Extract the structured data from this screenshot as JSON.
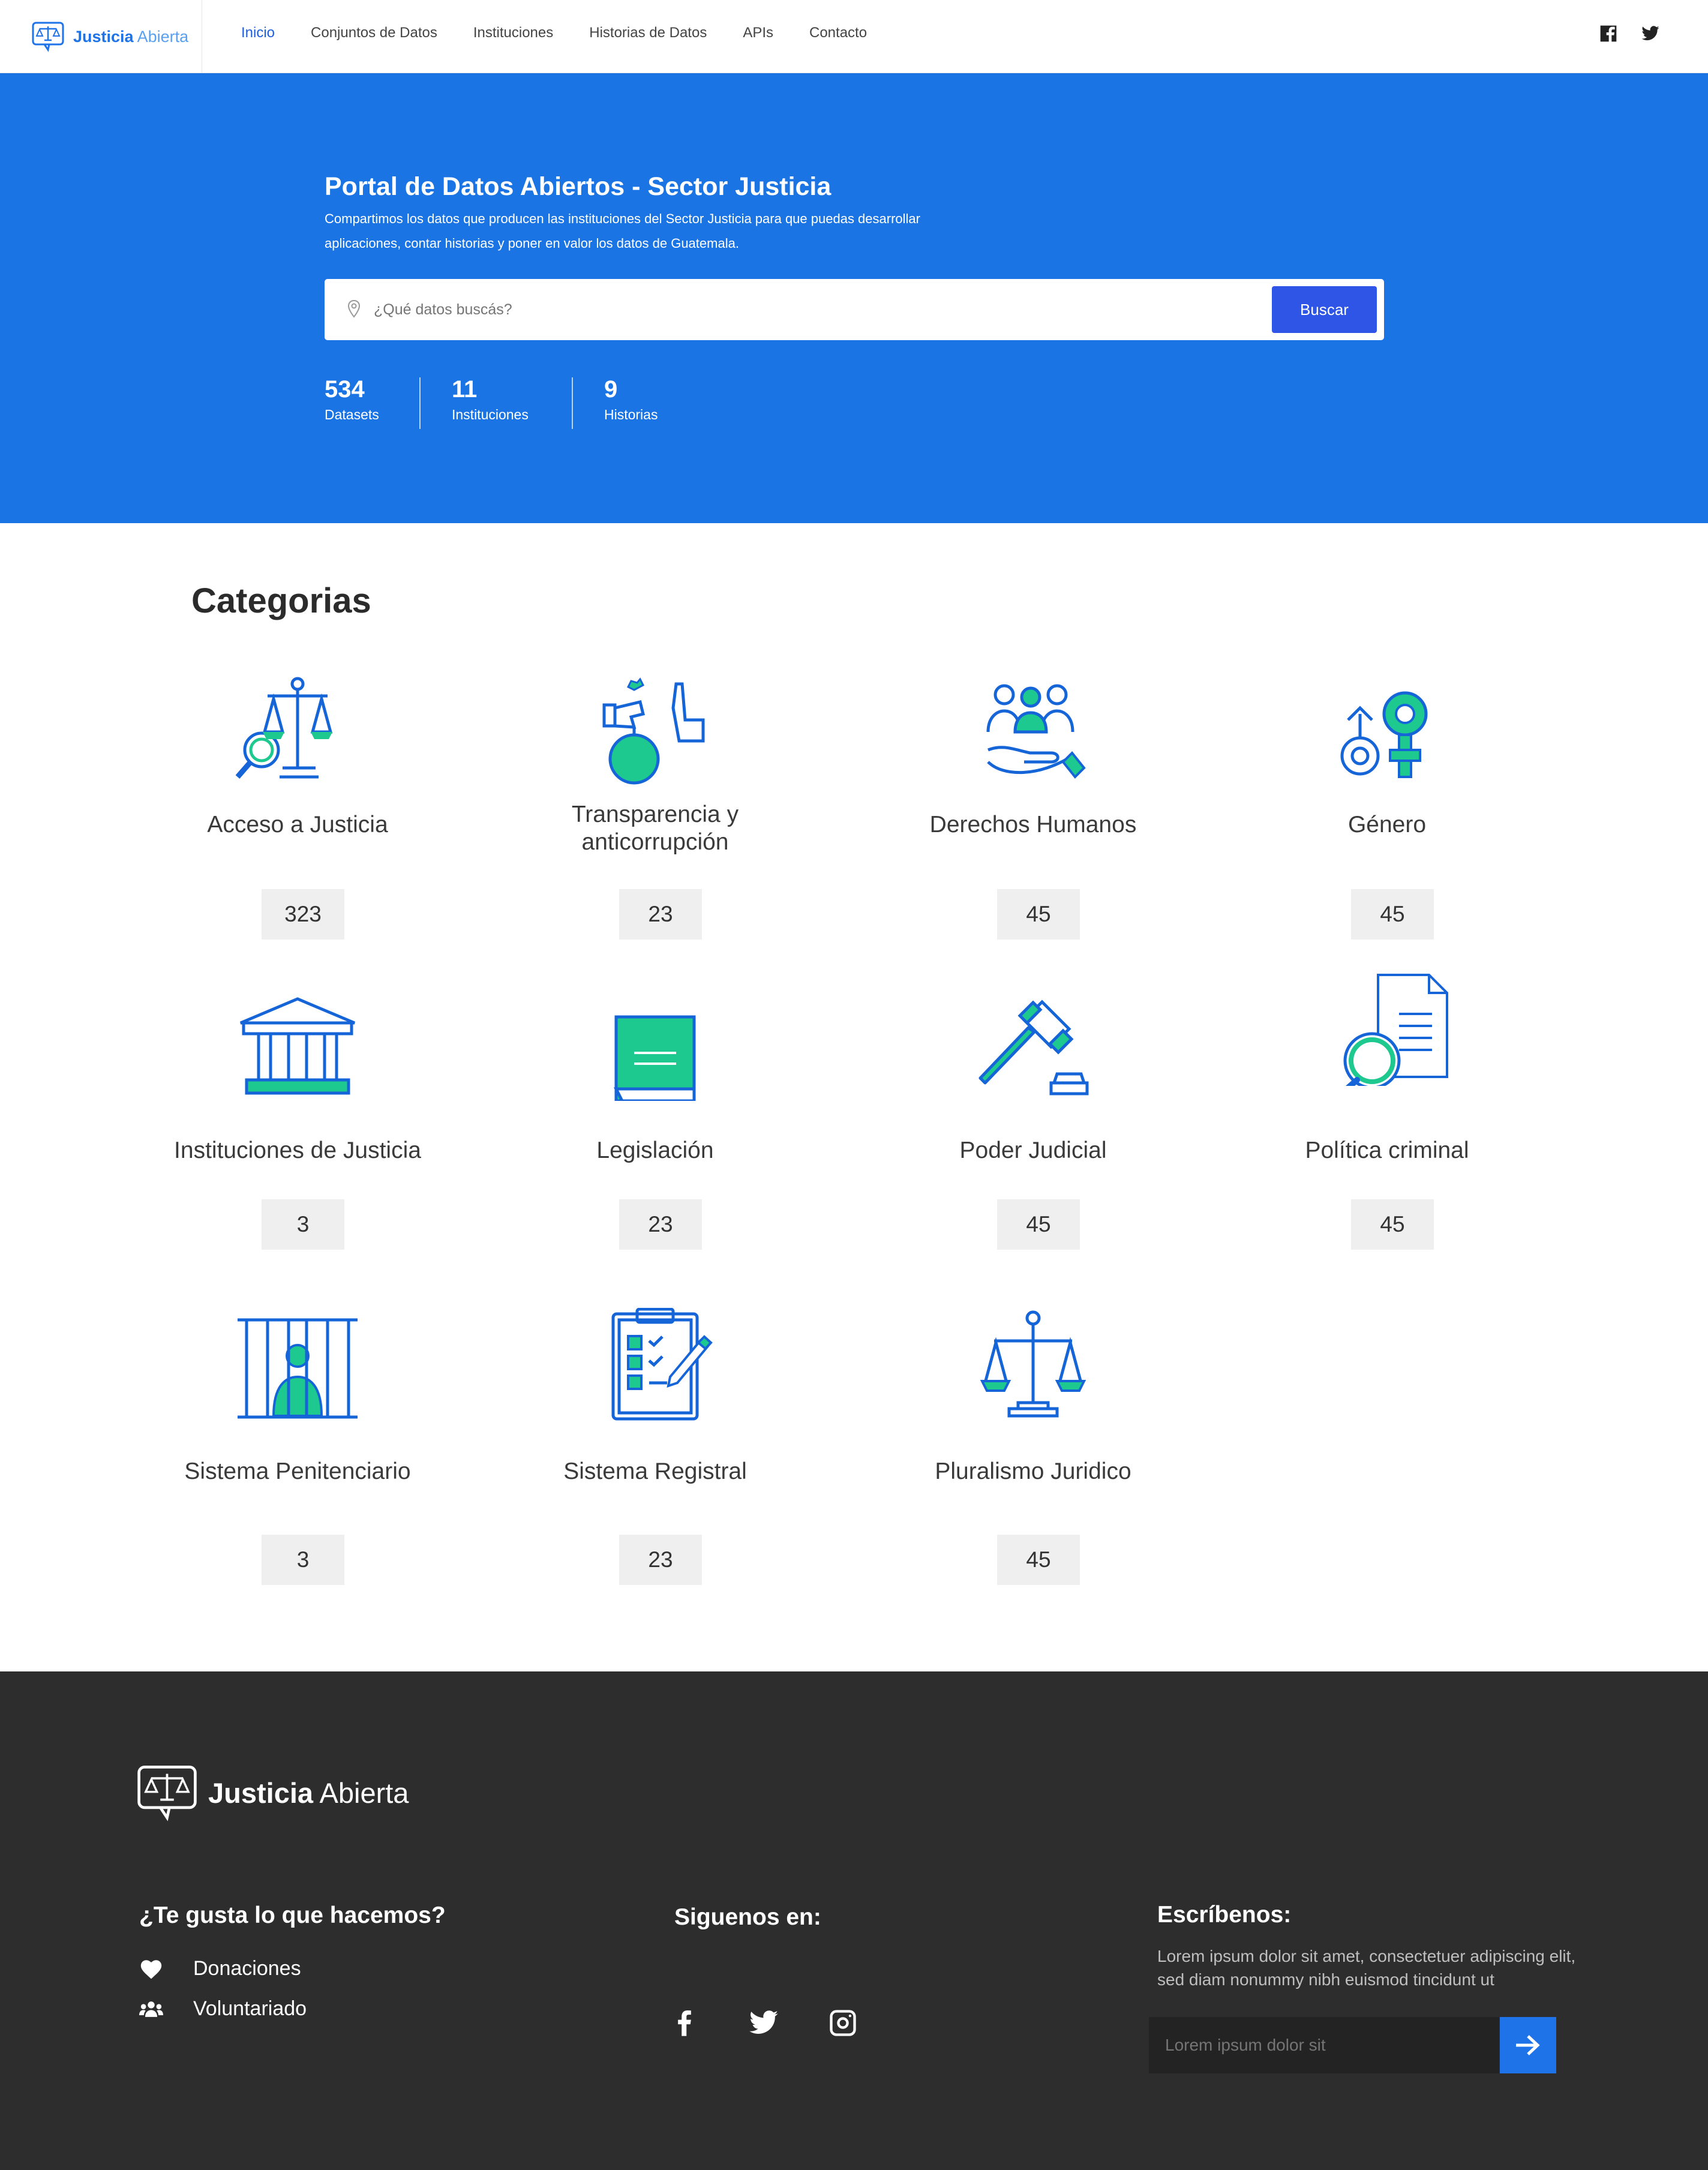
{
  "header": {
    "logo_bold": "Justicia",
    "logo_light": "Abierta",
    "nav": [
      "Inicio",
      "Conjuntos de Datos",
      "Instituciones",
      "Historias de Datos",
      "APIs",
      "Contacto"
    ],
    "social_icons": [
      "facebook-icon",
      "twitter-icon"
    ]
  },
  "hero": {
    "title": "Portal de Datos Abiertos - Sector Justicia",
    "subtitle": "Compartimos los datos que producen las instituciones del Sector Justicia para que puedas desarrollar aplicaciones, contar historias y poner en valor los datos de Guatemala.",
    "search_placeholder": "¿Qué datos buscás?",
    "search_button": "Buscar",
    "stats": [
      {
        "number": "534",
        "label": "Datasets"
      },
      {
        "number": "11",
        "label": "Instituciones"
      },
      {
        "number": "9",
        "label": "Historias"
      }
    ]
  },
  "categories": {
    "title": "Categorias",
    "items": [
      {
        "name": "Acceso a Justicia",
        "count": "323",
        "icon": "scales-magnifier-icon"
      },
      {
        "name": "Transparencia y anticorrupción",
        "count": "23",
        "icon": "bribe-hand-icon"
      },
      {
        "name": "Derechos Humanos",
        "count": "45",
        "icon": "people-hand-icon"
      },
      {
        "name": "Género",
        "count": "45",
        "icon": "gender-icon"
      },
      {
        "name": "Instituciones de Justicia",
        "count": "3",
        "icon": "courthouse-icon"
      },
      {
        "name": "Legislación",
        "count": "23",
        "icon": "book-icon"
      },
      {
        "name": "Poder Judicial",
        "count": "45",
        "icon": "gavel-icon"
      },
      {
        "name": "Política criminal",
        "count": "45",
        "icon": "document-search-icon"
      },
      {
        "name": "Sistema Penitenciario",
        "count": "3",
        "icon": "prison-icon"
      },
      {
        "name": "Sistema Registral",
        "count": "23",
        "icon": "clipboard-checklist-icon"
      },
      {
        "name": "Pluralismo Juridico",
        "count": "45",
        "icon": "scales-icon"
      }
    ]
  },
  "footer": {
    "logo_bold": "Justicia",
    "logo_light": "Abierta",
    "like_heading": "¿Te gusta lo que hacemos?",
    "links": [
      {
        "label": "Donaciones",
        "icon": "heart-icon"
      },
      {
        "label": "Voluntariado",
        "icon": "group-icon"
      }
    ],
    "follow_heading": "Siguenos en:",
    "social_icons": [
      "facebook-icon",
      "twitter-icon",
      "instagram-icon"
    ],
    "write_heading": "Escríbenos:",
    "write_text": "Lorem ipsum dolor sit amet, consectetuer adipiscing elit, sed diam nonummy nibh euismod tincidunt ut",
    "input_placeholder": "Lorem ipsum dolor sit"
  },
  "colors": {
    "primary_blue": "#1b74e4",
    "button_blue": "#2f55e6",
    "icon_blue": "#1565d8",
    "icon_green": "#1ec98f",
    "footer_bg": "#2d2d2e"
  }
}
